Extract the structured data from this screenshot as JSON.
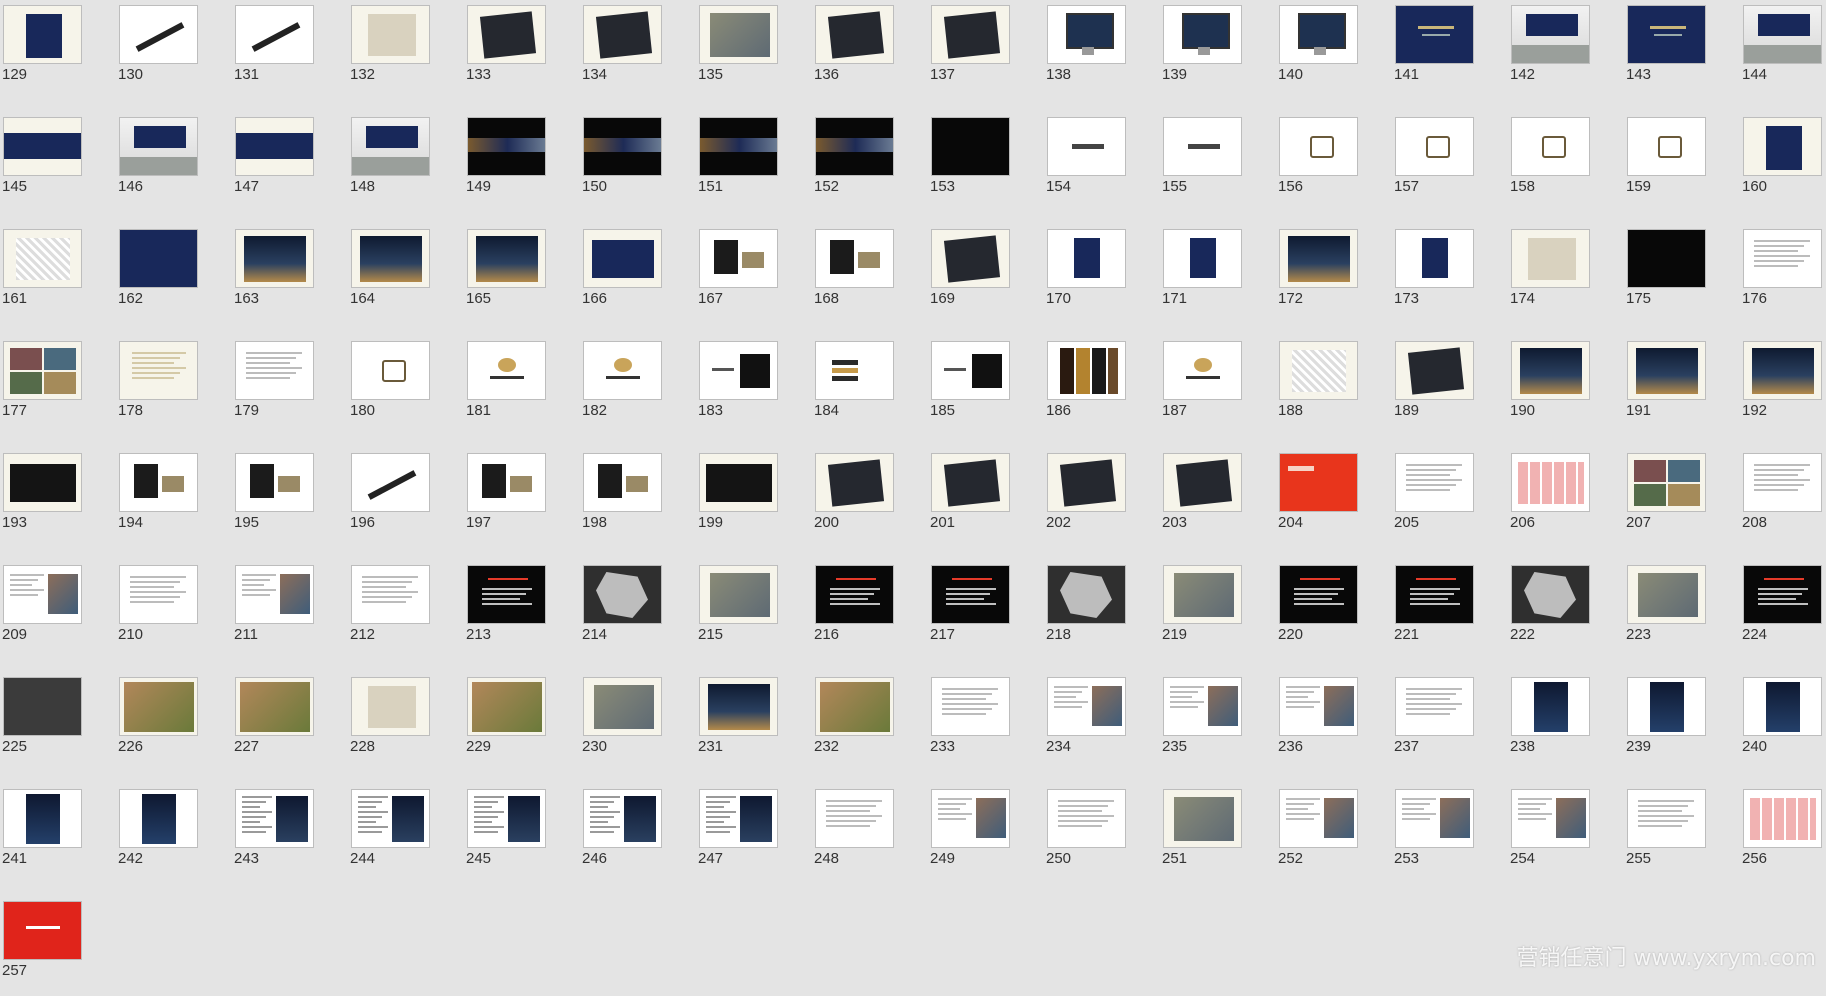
{
  "app": {
    "view": "Slide Sorter"
  },
  "watermark": "营销任意门 www.yxrym.com",
  "colors": {
    "background": "#e4e4e4",
    "cream": "#f6f4ea",
    "white": "#ffffff",
    "black": "#080808",
    "navy": "#18285a",
    "red": "#e8351c",
    "photo": "#7d7f7a",
    "gray": "#3b3b3b"
  },
  "columns": 16,
  "first_slide": 129,
  "slides": [
    {
      "n": "129",
      "t": "doc-navy"
    },
    {
      "n": "130",
      "t": "pen"
    },
    {
      "n": "131",
      "t": "pen"
    },
    {
      "n": "132",
      "t": "photo-light"
    },
    {
      "n": "133",
      "t": "dark-book"
    },
    {
      "n": "134",
      "t": "dark-book"
    },
    {
      "n": "135",
      "t": "photo"
    },
    {
      "n": "136",
      "t": "dark-book"
    },
    {
      "n": "137",
      "t": "dark-book"
    },
    {
      "n": "138",
      "t": "monitor"
    },
    {
      "n": "139",
      "t": "monitor"
    },
    {
      "n": "140",
      "t": "monitor"
    },
    {
      "n": "141",
      "t": "navy-banner"
    },
    {
      "n": "142",
      "t": "billboard"
    },
    {
      "n": "143",
      "t": "navy-banner"
    },
    {
      "n": "144",
      "t": "billboard"
    },
    {
      "n": "145",
      "t": "navy-strip"
    },
    {
      "n": "146",
      "t": "billboard"
    },
    {
      "n": "147",
      "t": "navy-strip"
    },
    {
      "n": "148",
      "t": "billboard"
    },
    {
      "n": "149",
      "t": "black-strip"
    },
    {
      "n": "150",
      "t": "black-strip"
    },
    {
      "n": "151",
      "t": "black-strip"
    },
    {
      "n": "152",
      "t": "black-strip"
    },
    {
      "n": "153",
      "t": "black"
    },
    {
      "n": "154",
      "t": "keys"
    },
    {
      "n": "155",
      "t": "keys"
    },
    {
      "n": "156",
      "t": "emblem"
    },
    {
      "n": "157",
      "t": "emblem"
    },
    {
      "n": "158",
      "t": "emblem"
    },
    {
      "n": "159",
      "t": "emblem"
    },
    {
      "n": "160",
      "t": "doc-navy"
    },
    {
      "n": "161",
      "t": "pattern"
    },
    {
      "n": "162",
      "t": "navy-full"
    },
    {
      "n": "163",
      "t": "night"
    },
    {
      "n": "164",
      "t": "night"
    },
    {
      "n": "165",
      "t": "night"
    },
    {
      "n": "166",
      "t": "navy-card"
    },
    {
      "n": "167",
      "t": "stationery"
    },
    {
      "n": "168",
      "t": "stationery"
    },
    {
      "n": "169",
      "t": "dark-book"
    },
    {
      "n": "170",
      "t": "book"
    },
    {
      "n": "171",
      "t": "book"
    },
    {
      "n": "172",
      "t": "night"
    },
    {
      "n": "173",
      "t": "book"
    },
    {
      "n": "174",
      "t": "photo-light"
    },
    {
      "n": "175",
      "t": "black"
    },
    {
      "n": "176",
      "t": "text"
    },
    {
      "n": "177",
      "t": "collage"
    },
    {
      "n": "178",
      "t": "sketch"
    },
    {
      "n": "179",
      "t": "text"
    },
    {
      "n": "180",
      "t": "emblem"
    },
    {
      "n": "181",
      "t": "logo"
    },
    {
      "n": "182",
      "t": "logo"
    },
    {
      "n": "183",
      "t": "logo-black"
    },
    {
      "n": "184",
      "t": "stripes"
    },
    {
      "n": "185",
      "t": "logo-black"
    },
    {
      "n": "186",
      "t": "columns"
    },
    {
      "n": "187",
      "t": "logo"
    },
    {
      "n": "188",
      "t": "pattern"
    },
    {
      "n": "189",
      "t": "dark-book"
    },
    {
      "n": "190",
      "t": "night"
    },
    {
      "n": "191",
      "t": "night"
    },
    {
      "n": "192",
      "t": "night"
    },
    {
      "n": "193",
      "t": "black-card"
    },
    {
      "n": "194",
      "t": "stationery"
    },
    {
      "n": "195",
      "t": "stationery"
    },
    {
      "n": "196",
      "t": "pen"
    },
    {
      "n": "197",
      "t": "stationery"
    },
    {
      "n": "198",
      "t": "stationery"
    },
    {
      "n": "199",
      "t": "black-card"
    },
    {
      "n": "200",
      "t": "dark-book"
    },
    {
      "n": "201",
      "t": "dark-book"
    },
    {
      "n": "202",
      "t": "dark-book"
    },
    {
      "n": "203",
      "t": "dark-book"
    },
    {
      "n": "204",
      "t": "red-title"
    },
    {
      "n": "205",
      "t": "text"
    },
    {
      "n": "206",
      "t": "table"
    },
    {
      "n": "207",
      "t": "collage"
    },
    {
      "n": "208",
      "t": "text"
    },
    {
      "n": "209",
      "t": "text-photo"
    },
    {
      "n": "210",
      "t": "text"
    },
    {
      "n": "211",
      "t": "text-photo"
    },
    {
      "n": "212",
      "t": "text"
    },
    {
      "n": "213",
      "t": "black-text"
    },
    {
      "n": "214",
      "t": "map"
    },
    {
      "n": "215",
      "t": "photo"
    },
    {
      "n": "216",
      "t": "black-text"
    },
    {
      "n": "217",
      "t": "black-text"
    },
    {
      "n": "218",
      "t": "map"
    },
    {
      "n": "219",
      "t": "photo"
    },
    {
      "n": "220",
      "t": "black-text"
    },
    {
      "n": "221",
      "t": "black-text"
    },
    {
      "n": "222",
      "t": "map"
    },
    {
      "n": "223",
      "t": "photo"
    },
    {
      "n": "224",
      "t": "black-text"
    },
    {
      "n": "225",
      "t": "dark-gray"
    },
    {
      "n": "226",
      "t": "photo-warm"
    },
    {
      "n": "227",
      "t": "photo-warm"
    },
    {
      "n": "228",
      "t": "photo-light"
    },
    {
      "n": "229",
      "t": "photo-warm"
    },
    {
      "n": "230",
      "t": "photo"
    },
    {
      "n": "231",
      "t": "night"
    },
    {
      "n": "232",
      "t": "photo-warm"
    },
    {
      "n": "233",
      "t": "text"
    },
    {
      "n": "234",
      "t": "text-photo"
    },
    {
      "n": "235",
      "t": "text-photo"
    },
    {
      "n": "236",
      "t": "text-photo"
    },
    {
      "n": "237",
      "t": "text"
    },
    {
      "n": "238",
      "t": "poster"
    },
    {
      "n": "239",
      "t": "poster"
    },
    {
      "n": "240",
      "t": "poster"
    },
    {
      "n": "241",
      "t": "poster"
    },
    {
      "n": "242",
      "t": "poster"
    },
    {
      "n": "243",
      "t": "newspaper"
    },
    {
      "n": "244",
      "t": "newspaper"
    },
    {
      "n": "245",
      "t": "newspaper"
    },
    {
      "n": "246",
      "t": "newspaper"
    },
    {
      "n": "247",
      "t": "newspaper"
    },
    {
      "n": "248",
      "t": "text"
    },
    {
      "n": "249",
      "t": "text-photo"
    },
    {
      "n": "250",
      "t": "text"
    },
    {
      "n": "251",
      "t": "photo"
    },
    {
      "n": "252",
      "t": "text-photo"
    },
    {
      "n": "253",
      "t": "text-photo"
    },
    {
      "n": "254",
      "t": "text-photo"
    },
    {
      "n": "255",
      "t": "text"
    },
    {
      "n": "256",
      "t": "table"
    },
    {
      "n": "257",
      "t": "red-full"
    }
  ]
}
